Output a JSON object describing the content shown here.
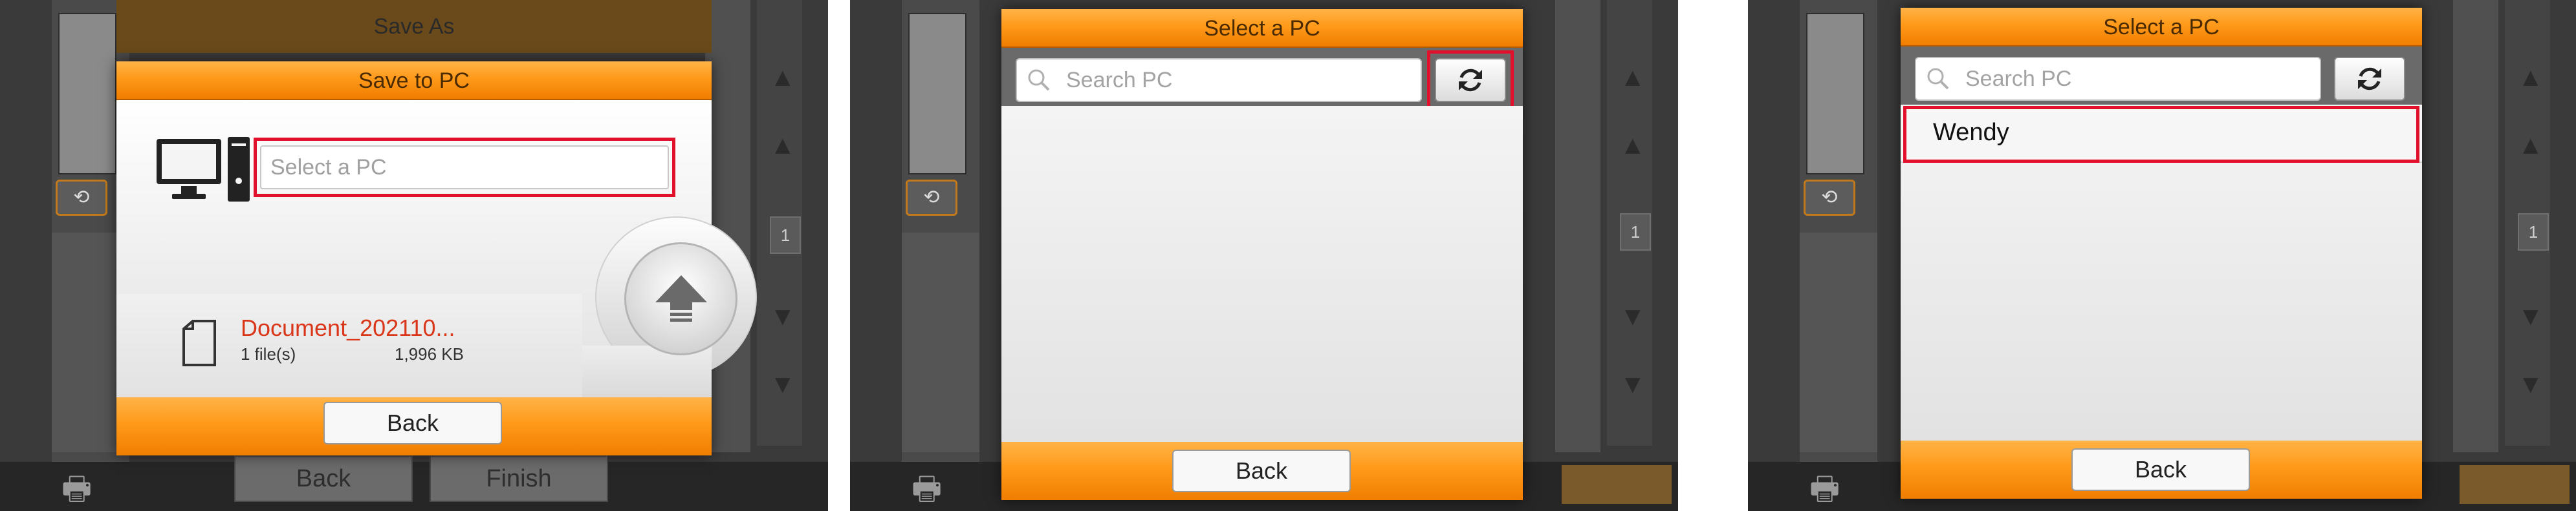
{
  "background": {
    "page_number": "1",
    "back_label": "Back",
    "finish_label": "Finish"
  },
  "panel1": {
    "save_as_title": "Save As",
    "dialog_title": "Save to PC",
    "select_pc_placeholder": "Select a PC",
    "file_name": "Document_202110...",
    "file_count": "1 file(s)",
    "file_size": "1,996 KB",
    "back_label": "Back"
  },
  "panel2": {
    "dialog_title": "Select a PC",
    "search_placeholder": "Search PC",
    "back_label": "Back"
  },
  "panel3": {
    "dialog_title": "Select a PC",
    "search_placeholder": "Search PC",
    "pc_list": [
      "Wendy"
    ],
    "back_label": "Back"
  },
  "colors": {
    "accent_orange": "#ff9a1a",
    "highlight_red": "#e0112b",
    "file_name_red": "#d9361a"
  },
  "icons": [
    "computer-icon",
    "document-icon",
    "upload-icon",
    "search-icon",
    "refresh-icon",
    "rotate-icon",
    "scanner-icon",
    "up-arrow-icon",
    "down-arrow-icon"
  ]
}
